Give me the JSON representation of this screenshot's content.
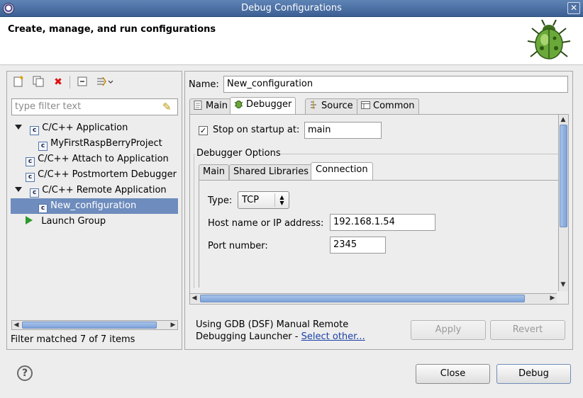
{
  "window": {
    "title": "Debug Configurations"
  },
  "header": {
    "title": "Create, manage, and run configurations"
  },
  "left": {
    "filter_placeholder": "type filter text",
    "tree": [
      {
        "label": "C/C++ Application"
      },
      {
        "label": "MyFirstRaspBerryProject"
      },
      {
        "label": "C/C++ Attach to Application"
      },
      {
        "label": "C/C++ Postmortem Debugger"
      },
      {
        "label": "C/C++ Remote Application"
      },
      {
        "label": "New_configuration"
      },
      {
        "label": "Launch Group"
      }
    ],
    "status": "Filter matched 7 of 7 items"
  },
  "right": {
    "name_label": "Name:",
    "name_value": "New_configuration",
    "tabs": [
      "Main",
      "Debugger",
      "Source",
      "Common"
    ],
    "stop_on_startup": {
      "label": "Stop on startup at:",
      "checked": true,
      "value": "main"
    },
    "options_label": "Debugger Options",
    "subtabs": [
      "Main",
      "Shared Libraries",
      "Connection"
    ],
    "type_label": "Type:",
    "type_value": "TCP",
    "host_label": "Host name or IP address:",
    "host_value": "192.168.1.54",
    "port_label": "Port number:",
    "port_value": "2345",
    "launcher_text": "Using GDB (DSF) Manual Remote",
    "launcher_text2": "Debugging Launcher - ",
    "launcher_link": "Select other...",
    "apply": "Apply",
    "revert": "Revert"
  },
  "footer": {
    "close": "Close",
    "debug": "Debug"
  }
}
